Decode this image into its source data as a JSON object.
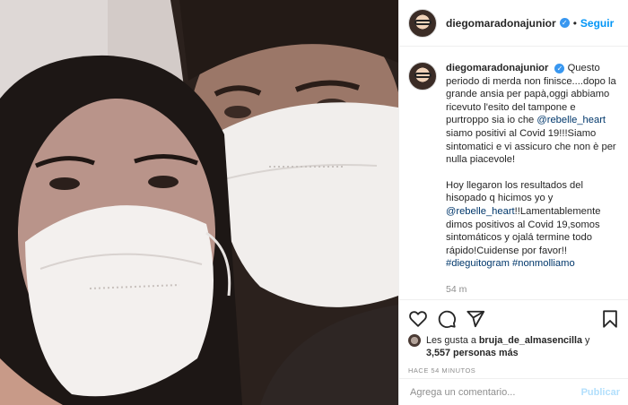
{
  "post": {
    "username": "diegomaradonajunior",
    "follow_label": "Seguir",
    "separator": "•",
    "caption": {
      "line_it_1": "Questo periodo di merda non finisce....dopo la grande ansia per papà,oggi abbiamo ricevuto l'esito del tampone e purtroppo sia io che ",
      "mention_1": "@rebelle_heart",
      "line_it_2": " siamo positivi al Covid 19!!!Siamo sintomatici e vi assicuro che non è per nulla piacevole!",
      "line_es_1": "Hoy llegaron los resultados del hisopado q hicimos yo y ",
      "mention_2": "@rebelle_heart",
      "line_es_2": "!!Lamentablemente dimos positivos al Covid 19,somos sintomáticos y ojalá termine todo rápido!Cuidense por favor!!",
      "hashtag_1": "#dieguitogram",
      "hashtag_2": "#nonmolliamo"
    },
    "caption_time": "54 m",
    "likes": {
      "prefix": "Les gusta a ",
      "user": "bruja_de_almasencilla",
      "joiner": " y",
      "count": "3,557 personas más"
    },
    "posted_time": "HACE 54 MINUTOS",
    "comment_placeholder": "Agrega un comentario...",
    "publish_label": "Publicar"
  },
  "icons": {
    "like": "heart-icon",
    "comment": "comment-icon",
    "share": "paper-plane-icon",
    "save": "bookmark-icon",
    "verified": "verified-badge-icon"
  },
  "colors": {
    "link_blue": "#0095f6",
    "mention_blue": "#00376b",
    "verified": "#3897f0",
    "muted": "#8e8e8e"
  }
}
